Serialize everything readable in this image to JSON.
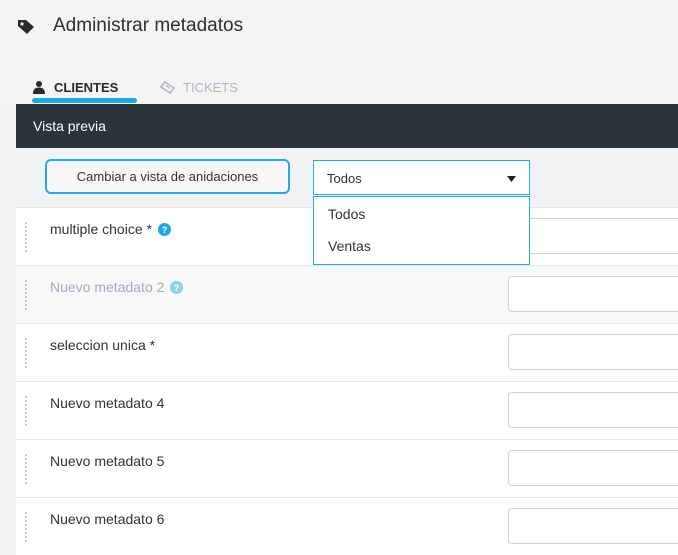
{
  "header": {
    "title": "Administrar metadatos",
    "icon": "tag-icon"
  },
  "tabs": [
    {
      "label": "CLIENTES",
      "icon": "user-icon",
      "active": true
    },
    {
      "label": "TICKETS",
      "icon": "ticket-icon",
      "active": false
    }
  ],
  "panel": {
    "title": "Vista previa"
  },
  "toolbar": {
    "switch_label": "Cambiar a vista de anidaciones",
    "select_value": "Todos",
    "options": [
      "Todos",
      "Ventas"
    ]
  },
  "rows": [
    {
      "label": "multiple choice *",
      "help": true,
      "faded": false
    },
    {
      "label": "Nuevo metadato 2",
      "help": true,
      "faded": true
    },
    {
      "label": "seleccion unica *",
      "help": false,
      "faded": false
    },
    {
      "label": "Nuevo metadato 4",
      "help": false,
      "faded": false
    },
    {
      "label": "Nuevo metadato 5",
      "help": false,
      "faded": false
    },
    {
      "label": "Nuevo metadato 6",
      "help": false,
      "faded": false
    }
  ],
  "colors": {
    "accent": "#2ba9df",
    "panel_header": "#2b343c",
    "help_icon": "#1fa8e0"
  }
}
